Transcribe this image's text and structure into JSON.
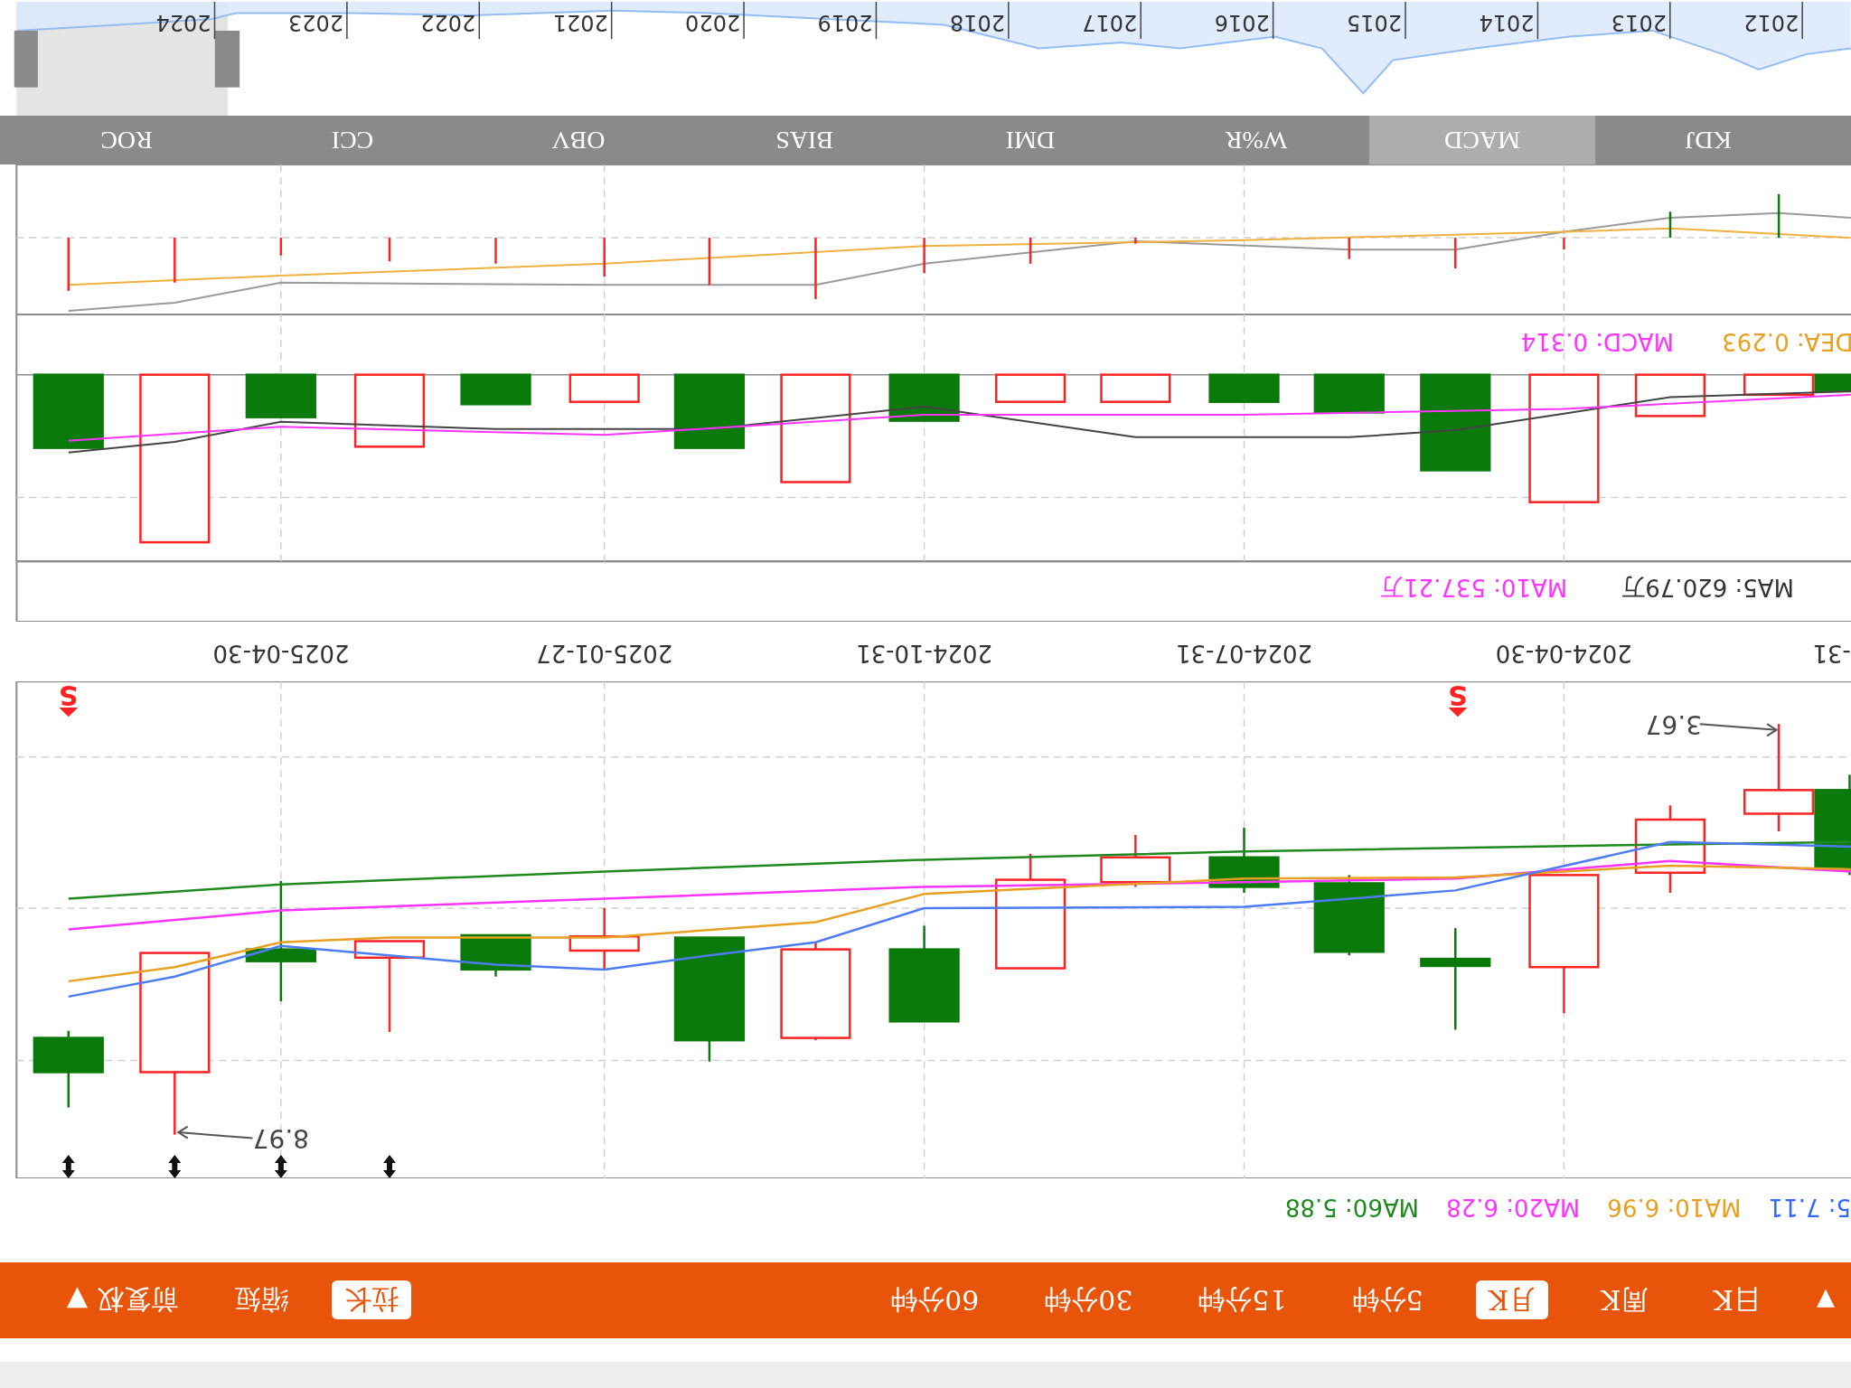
{
  "toolbar": {
    "menu_caret": "▼",
    "periods": [
      {
        "label": "日K",
        "selected": false
      },
      {
        "label": "周K",
        "selected": false
      },
      {
        "label": "月K",
        "selected": true
      },
      {
        "label": "5分钟",
        "selected": false
      },
      {
        "label": "15分钟",
        "selected": false
      },
      {
        "label": "30分钟",
        "selected": false
      },
      {
        "label": "60分钟",
        "selected": false
      }
    ],
    "zoom": [
      {
        "label": "拉长",
        "selected": true
      },
      {
        "label": "缩短",
        "selected": false
      }
    ],
    "adjust": {
      "label": "前复权",
      "caret": "▼"
    }
  },
  "ma_legend": [
    {
      "label": "5: 7.11",
      "color": "#3366ff"
    },
    {
      "label": "MA10: 6.96",
      "color": "#e8a020"
    },
    {
      "label": "MA20: 6.28",
      "color": "#ff33ff"
    },
    {
      "label": "MA60: 5.88",
      "color": "#1e8a1e"
    }
  ],
  "price_chart": {
    "signals": [
      "S",
      "S"
    ],
    "annotations": [
      "3.67",
      "8.97"
    ]
  },
  "dates": [
    "-31",
    "2024-04-30",
    "2024-07-31",
    "2024-10-31",
    "2025-01-27",
    "2025-04-30"
  ],
  "volume_legend": [
    {
      "label": "MA5: 620.79万",
      "color": "#333333"
    },
    {
      "label": "MA10: 537.21万",
      "color": "#ff33ff"
    }
  ],
  "macd_legend": [
    {
      "label": "DEA: 0.293",
      "color": "#e8a020"
    },
    {
      "label": "MACD: 0.314",
      "color": "#ff33ff"
    }
  ],
  "indicator_tabs": [
    {
      "label": "KDJ",
      "selected": false
    },
    {
      "label": "MACD",
      "selected": true
    },
    {
      "label": "W%R",
      "selected": false
    },
    {
      "label": "DMI",
      "selected": false
    },
    {
      "label": "BIAS",
      "selected": false
    },
    {
      "label": "OBV",
      "selected": false
    },
    {
      "label": "CCI",
      "selected": false
    },
    {
      "label": "ROC",
      "selected": false
    }
  ],
  "navigator": {
    "years": [
      "2012",
      "2013",
      "2014",
      "2015",
      "2016",
      "2017",
      "2018",
      "2019",
      "2020",
      "2021",
      "2022",
      "2023",
      "2024"
    ]
  }
}
